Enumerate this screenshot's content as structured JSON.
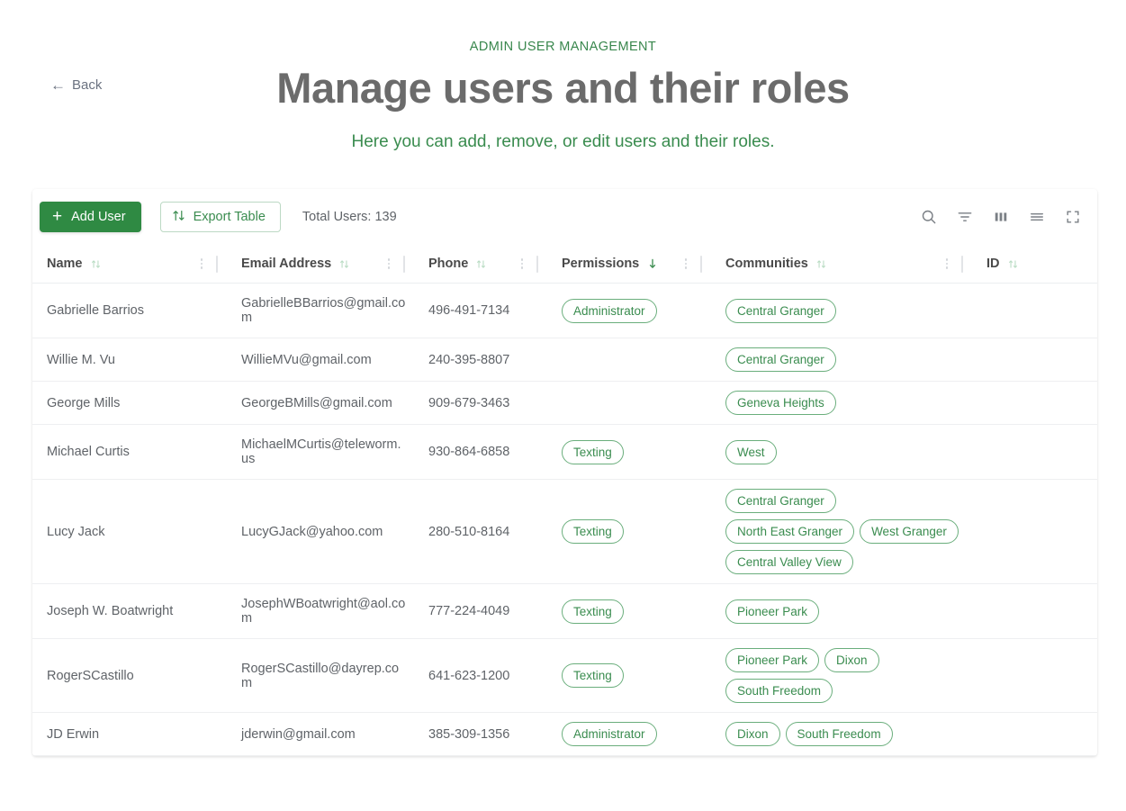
{
  "header": {
    "back_label": "Back",
    "eyebrow": "ADMIN USER MANAGEMENT",
    "title": "Manage users and their roles",
    "subtitle": "Here you can add, remove, or edit users and their roles."
  },
  "colors": {
    "brand_green": "#2f8a43",
    "accent_green": "#3a8c4f",
    "chip_border": "#6aae7c",
    "title_grey": "#6b6b6b"
  },
  "toolbar": {
    "add_user_label": "Add User",
    "add_user_icon": "plus-icon",
    "export_label": "Export Table",
    "export_icon": "sort-updown-icon",
    "total_users_label": "Total Users: 139",
    "icons": [
      {
        "name": "search-icon",
        "label": "Search"
      },
      {
        "name": "filter-icon",
        "label": "Filter"
      },
      {
        "name": "columns-icon",
        "label": "Columns"
      },
      {
        "name": "density-icon",
        "label": "Density"
      },
      {
        "name": "fullscreen-icon",
        "label": "Fullscreen"
      }
    ]
  },
  "table": {
    "columns": [
      {
        "key": "name",
        "label": "Name",
        "sort": "none"
      },
      {
        "key": "email",
        "label": "Email Address",
        "sort": "none"
      },
      {
        "key": "phone",
        "label": "Phone",
        "sort": "none"
      },
      {
        "key": "permissions",
        "label": "Permissions",
        "sort": "desc"
      },
      {
        "key": "communities",
        "label": "Communities",
        "sort": "none"
      },
      {
        "key": "id",
        "label": "ID",
        "sort": "none"
      }
    ],
    "rows": [
      {
        "name": "Gabrielle Barrios",
        "email": "GabrielleBBarrios@gmail.com",
        "phone": "496-491-7134",
        "permissions": [
          "Administrator"
        ],
        "communities": [
          "Central Granger"
        ],
        "id": ""
      },
      {
        "name": "Willie M. Vu",
        "email": "WillieMVu@gmail.com",
        "phone": "240-395-8807",
        "permissions": [],
        "communities": [
          "Central Granger"
        ],
        "id": ""
      },
      {
        "name": "George Mills",
        "email": "GeorgeBMills@gmail.com",
        "phone": "909-679-3463",
        "permissions": [],
        "communities": [
          "Geneva Heights"
        ],
        "id": ""
      },
      {
        "name": "Michael Curtis",
        "email": "MichaelMCurtis@teleworm.us",
        "phone": "930-864-6858",
        "permissions": [
          "Texting"
        ],
        "communities": [
          "West"
        ],
        "id": ""
      },
      {
        "name": "Lucy Jack",
        "email": "LucyGJack@yahoo.com",
        "phone": "280-510-8164",
        "permissions": [
          "Texting"
        ],
        "communities": [
          "Central Granger",
          "North East Granger",
          "West Granger",
          "Central Valley View"
        ],
        "id": ""
      },
      {
        "name": "Joseph W. Boatwright",
        "email": "JosephWBoatwright@aol.com",
        "phone": "777-224-4049",
        "permissions": [
          "Texting"
        ],
        "communities": [
          "Pioneer Park"
        ],
        "id": ""
      },
      {
        "name": "RogerSCastillo",
        "email": "RogerSCastillo@dayrep.com",
        "phone": "641-623-1200",
        "permissions": [
          "Texting"
        ],
        "communities": [
          "Pioneer Park",
          "Dixon",
          "South Freedom"
        ],
        "id": ""
      },
      {
        "name": "JD Erwin",
        "email": "jderwin@gmail.com",
        "phone": "385-309-1356",
        "permissions": [
          "Administrator"
        ],
        "communities": [
          "Dixon",
          "South Freedom"
        ],
        "id": ""
      }
    ]
  }
}
